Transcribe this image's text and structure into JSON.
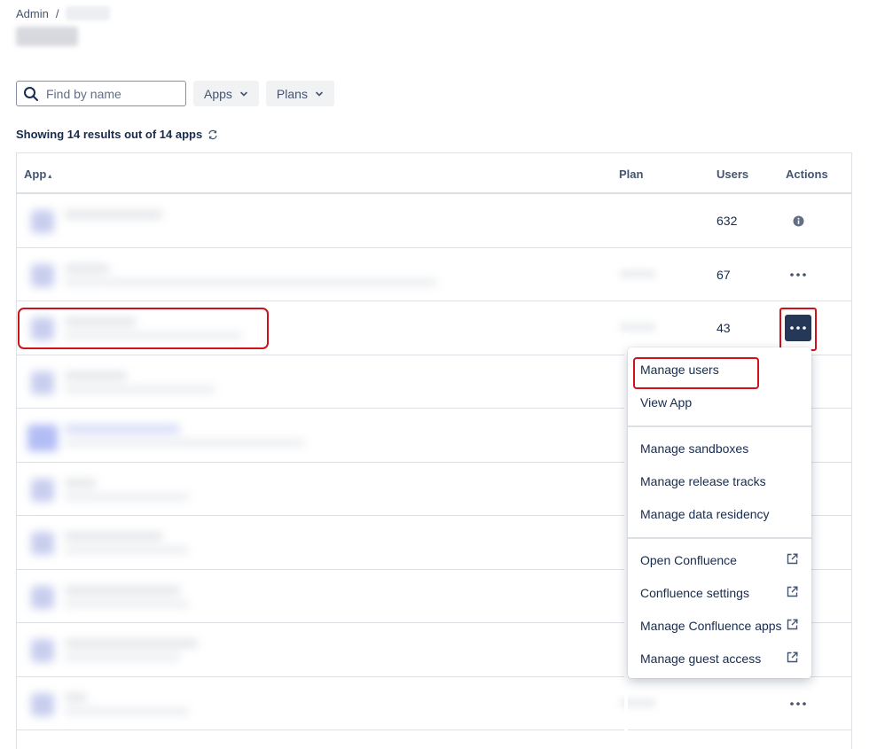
{
  "breadcrumb": {
    "root": "Admin",
    "separator": "/"
  },
  "search": {
    "placeholder": "Find by name",
    "value": ""
  },
  "filters": {
    "apps_label": "Apps",
    "plans_label": "Plans"
  },
  "results_text": "Showing 14 results out of 14 apps",
  "table": {
    "columns": {
      "app": "App",
      "sort_indicator": "▴",
      "plan": "Plan",
      "users": "Users",
      "actions": "Actions"
    },
    "rows": [
      {
        "users": "632",
        "action": "info-icon"
      },
      {
        "users": "67",
        "action": "more-icon"
      },
      {
        "users": "43",
        "action": "more-icon-active"
      },
      {
        "users": "",
        "action": ""
      },
      {
        "users": "",
        "action": ""
      },
      {
        "users": "",
        "action": ""
      },
      {
        "users": "",
        "action": ""
      },
      {
        "users": "",
        "action": ""
      },
      {
        "users": "",
        "action": ""
      },
      {
        "users": "",
        "action": "more-icon"
      }
    ]
  },
  "menu": {
    "manage_users": "Manage users",
    "view_app": "View App",
    "manage_sandboxes": "Manage sandboxes",
    "manage_release_tracks": "Manage release tracks",
    "manage_data_residency": "Manage data residency",
    "open_confluence": "Open Confluence",
    "confluence_settings": "Confluence settings",
    "manage_confluence_apps": "Manage Confluence apps",
    "manage_guest_access": "Manage guest access"
  },
  "colors": {
    "highlight": "#d0101b",
    "active_button": "#253858",
    "text": "#172b4d"
  }
}
